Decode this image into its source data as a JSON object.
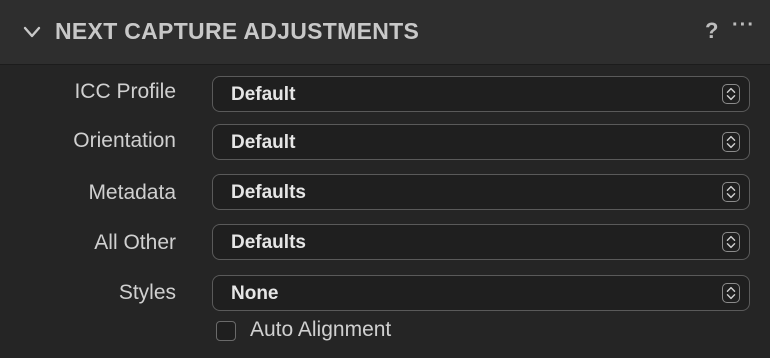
{
  "header": {
    "title": "NEXT CAPTURE ADJUSTMENTS",
    "help_label": "?",
    "more_label": "···",
    "collapse_icon": "chevron-down-icon"
  },
  "rows": [
    {
      "label": "ICC Profile",
      "value": "Default"
    },
    {
      "label": "Orientation",
      "value": "Default"
    },
    {
      "label": "Metadata",
      "value": "Defaults"
    },
    {
      "label": "All Other",
      "value": "Defaults"
    },
    {
      "label": "Styles",
      "value": "None"
    }
  ],
  "auto_alignment": {
    "label": "Auto Alignment",
    "checked": false
  },
  "colors": {
    "panel_bg": "#252525",
    "header_bg": "#2e2e2e",
    "text": "#d0d0d0",
    "select_border": "#5a5a5a"
  }
}
